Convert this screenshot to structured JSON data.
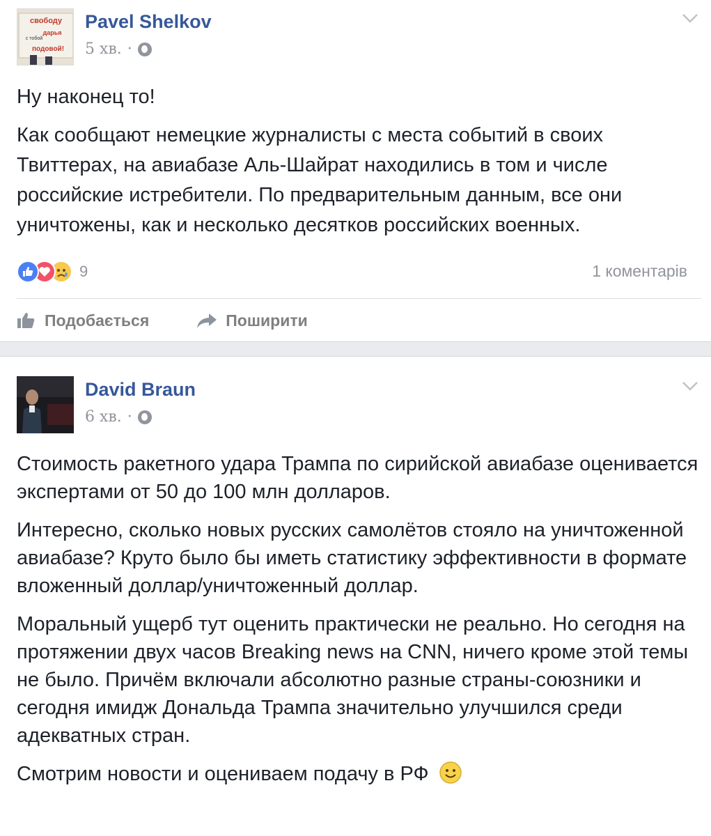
{
  "posts": [
    {
      "author": "Pavel Shelkov",
      "time": "5 хв.",
      "dot": "·",
      "avatar_sign_lines": [
        "свободу",
        "дарья",
        "с тобой",
        "подовой!"
      ],
      "paragraphs": [
        "Ну наконец то!",
        "Как сообщают немецкие журналисты с места событий в своих Твиттерах, на авиабазе Аль-Шайрат находились в том и числе российские истребители. По предварительным данным, все они уничтожены, как и несколько десятков российских военных."
      ],
      "reaction_count": "9",
      "comments": "1 коментарів",
      "actions": {
        "like": "Подобається",
        "share": "Поширити"
      }
    },
    {
      "author": "David Braun",
      "time": "6 хв.",
      "dot": "·",
      "paragraphs": [
        "Стоимость ракетного удара Трампа по сирийской авиабазе оценивается экспертами от 50 до 100 млн долларов.",
        "Интересно, сколько новых русских самолётов стояло на уничтоженной авиабазе? Круто было бы иметь статистику эффективности в формате вложенный доллар/уничтоженный доллар.",
        "Моральный ущерб тут оценить практически не реально. Но сегодня на протяжении двух часов Breaking news на CNN, ничего кроме этой темы не было. Причём включали абсолютно разные страны-союзники и сегодня имидж Дональда Трампа значительно улучшился среди адекватных стран.",
        "Смотрим новости и оцениваем подачу в РФ"
      ]
    }
  ],
  "colors": {
    "name": "#365899",
    "meta": "#90949c",
    "text": "#1d2129",
    "separator": "#e9ebee"
  },
  "icons": [
    "chevron-down-icon",
    "globe-icon",
    "like-reaction-icon",
    "love-reaction-icon",
    "sad-reaction-icon",
    "thumbs-up-icon",
    "share-arrow-icon",
    "smile-emoji-icon"
  ]
}
